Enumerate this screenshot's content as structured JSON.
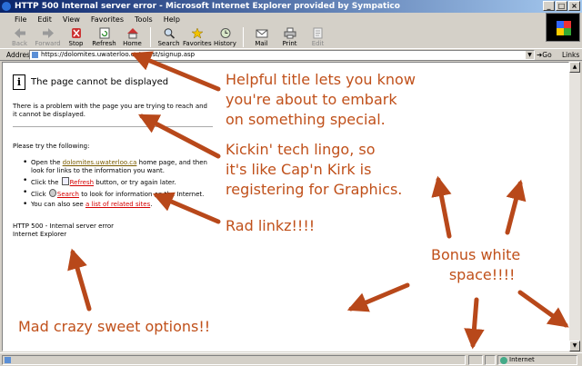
{
  "window": {
    "title": "HTTP 500 Internal server error - Microsoft Internet Explorer provided by Sympatico",
    "btn_min": "_",
    "btn_max": "□",
    "btn_close": "×"
  },
  "menu": [
    "File",
    "Edit",
    "View",
    "Favorites",
    "Tools",
    "Help"
  ],
  "toolbar": {
    "back": "Back",
    "forward": "Forward",
    "stop": "Stop",
    "refresh": "Refresh",
    "home": "Home",
    "search": "Search",
    "favorites": "Favorites",
    "history": "History",
    "mail": "Mail",
    "print": "Print",
    "edit": "Edit"
  },
  "address": {
    "label": "Address",
    "url": "https://dolomites.uwaterloo.ca/quest/signup.asp",
    "go": "Go",
    "links": "Links"
  },
  "page": {
    "title": "The page cannot be displayed",
    "description": "There is a problem with the page you are trying to reach and it cannot be displayed.",
    "try_heading": "Please try the following:",
    "items": {
      "open_prefix": "Open the ",
      "open_link": "dolomites.uwaterloo.ca",
      "open_suffix": " home page, and then look for links to the information you want.",
      "click1_prefix": "Click the ",
      "refresh_link": "Refresh",
      "click1_suffix": " button, or try again later.",
      "click2_prefix": "Click ",
      "search_link": "Search",
      "click2_suffix": " to look for information on the Internet.",
      "also_prefix": "You can also see ",
      "related_link": "a list of related sites",
      "also_suffix": "."
    },
    "http_code": "HTTP 500 - Internal server error",
    "browser": "Internet Explorer"
  },
  "status": {
    "zone": "Internet"
  },
  "annotations": {
    "note1_line1": "Helpful title lets you know",
    "note1_line2": "you're about to embark",
    "note1_line3": "on something special.",
    "note2_line1": "Kickin' tech lingo, so",
    "note2_line2": "it's like Cap'n Kirk is",
    "note2_line3": "registering for Graphics.",
    "note3": "Rad linkz!!!!",
    "note4_line1": "Bonus white",
    "note4_line2": "space!!!!",
    "note5": "Mad crazy sweet options!!",
    "color": "#c0501a"
  }
}
